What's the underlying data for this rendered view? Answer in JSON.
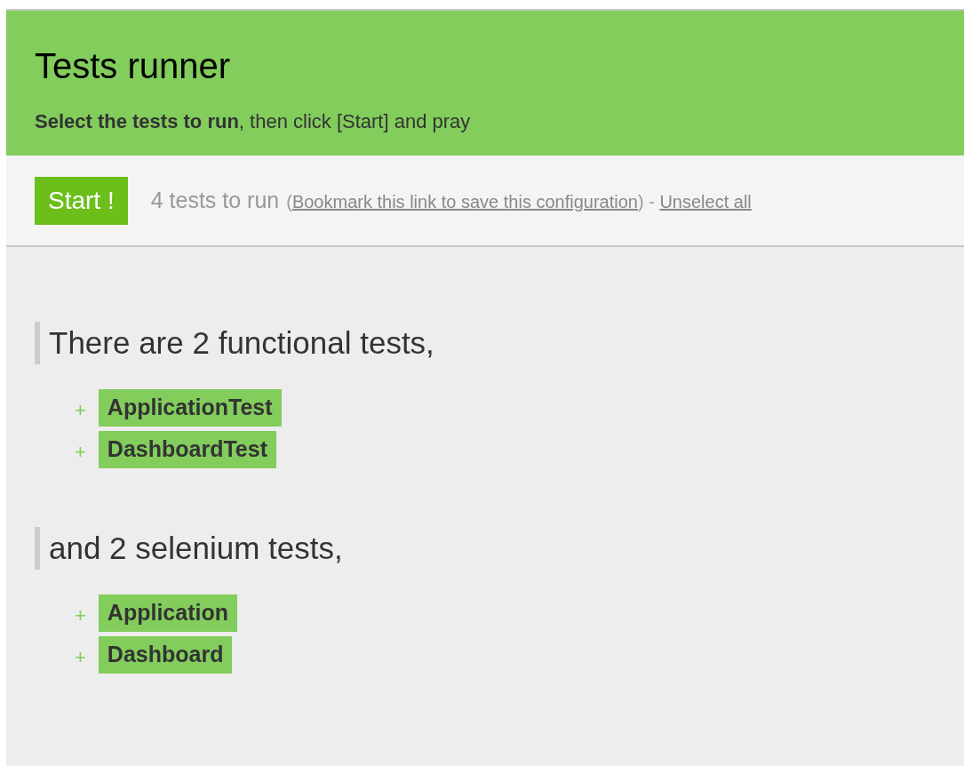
{
  "header": {
    "title": "Tests runner",
    "subtitle": "**Select the tests to run**, then click [Start] and pray"
  },
  "toolbar": {
    "start_button": "Start !",
    "count": "4 tests to run",
    "note": [
      {
        "kind": "text",
        "text": "("
      },
      {
        "kind": "link",
        "text": "Bookmark this link to save this configuration"
      },
      {
        "kind": "text",
        "text": ") - "
      },
      {
        "kind": "link",
        "text": "Unselect all"
      }
    ]
  },
  "groups": [
    {
      "heading": "There are 2 functional tests,",
      "tests": [
        {
          "marker": "+",
          "name": "ApplicationTest",
          "selected": true
        },
        {
          "marker": "+",
          "name": "DashboardTest",
          "selected": true
        }
      ]
    },
    {
      "heading": "and 2 selenium tests,",
      "tests": [
        {
          "marker": "+",
          "name": "Application",
          "selected": true
        },
        {
          "marker": "+",
          "name": "Dashboard",
          "selected": true
        }
      ]
    }
  ]
}
